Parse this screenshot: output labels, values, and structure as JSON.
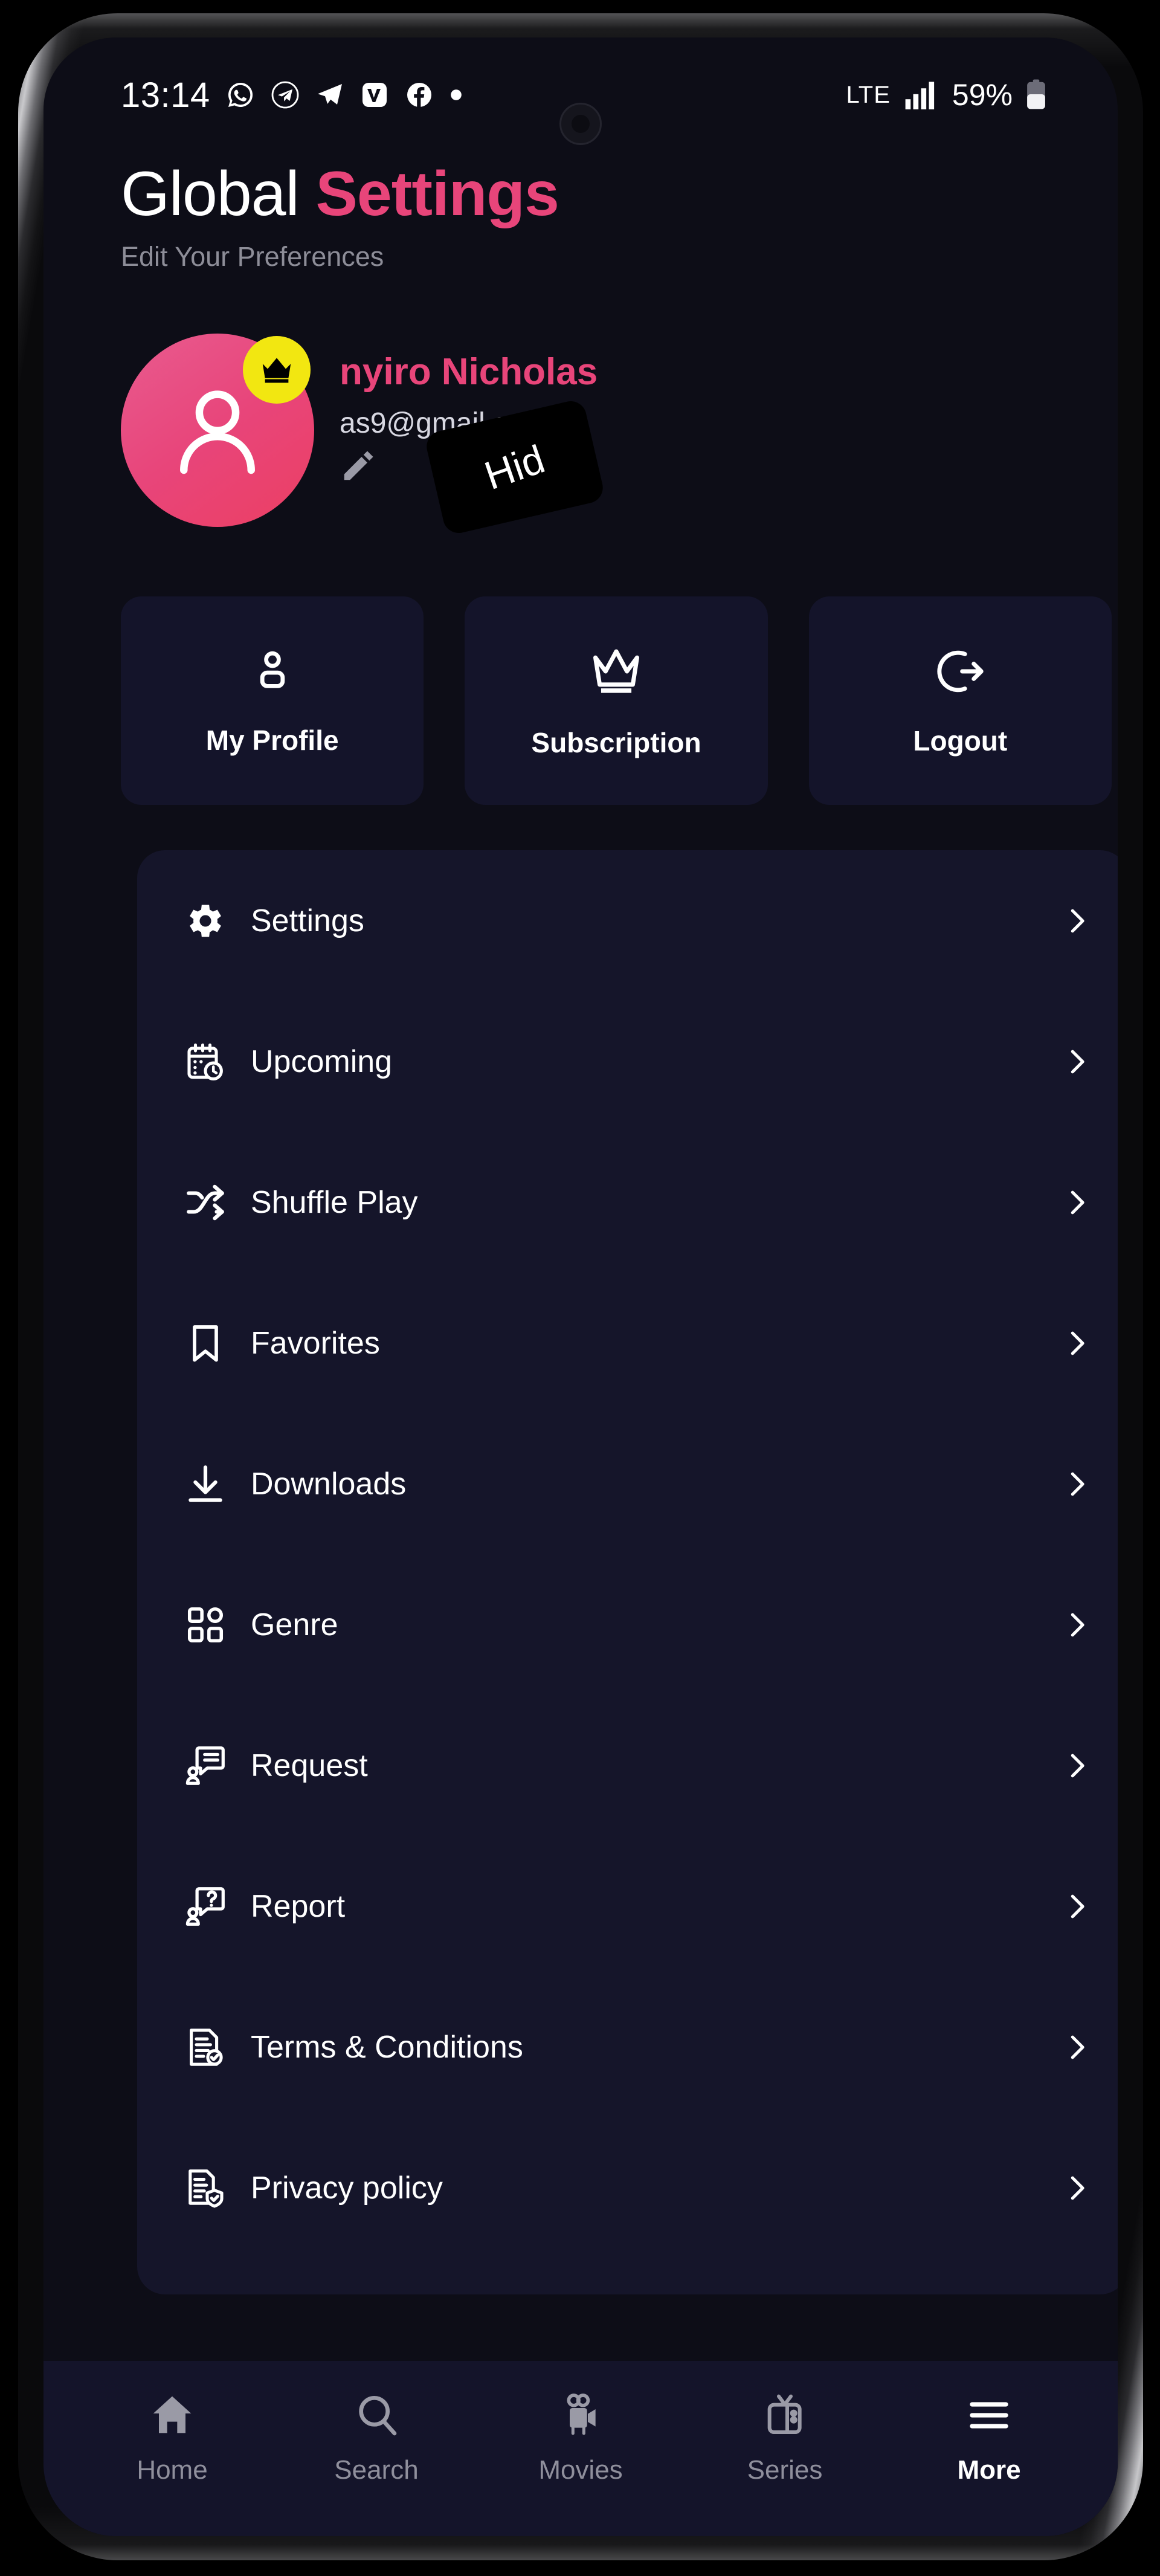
{
  "status_bar": {
    "time": "13:14",
    "app_icons": [
      "whatsapp-icon",
      "telegram-alt-icon",
      "telegram-icon",
      "vimeo-icon",
      "facebook-icon",
      "dot-icon"
    ],
    "network": "LTE",
    "signal": "signal-bars-icon",
    "battery_percent": "59%",
    "battery": "battery-icon"
  },
  "header": {
    "title_primary": "Global",
    "title_accent": "Settings",
    "subtitle": "Edit Your Preferences"
  },
  "profile": {
    "name": "nyiro Nicholas",
    "email": "as9@gmail.com",
    "badge_icon": "crown-icon",
    "avatar_icon": "person-icon",
    "edit_icon": "pencil-icon",
    "overlay_label": "Hid"
  },
  "quick_actions": [
    {
      "label": "My Profile",
      "icon": "person-icon"
    },
    {
      "label": "Subscription",
      "icon": "crown-icon"
    },
    {
      "label": "Logout",
      "icon": "logout-icon"
    }
  ],
  "menu": [
    {
      "label": "Settings",
      "icon": "gear-icon"
    },
    {
      "label": "Upcoming",
      "icon": "calendar-clock-icon"
    },
    {
      "label": "Shuffle Play",
      "icon": "shuffle-icon"
    },
    {
      "label": "Favorites",
      "icon": "bookmark-icon"
    },
    {
      "label": "Downloads",
      "icon": "download-icon"
    },
    {
      "label": "Genre",
      "icon": "grid-icon"
    },
    {
      "label": "Request",
      "icon": "person-message-icon"
    },
    {
      "label": "Report",
      "icon": "person-question-icon"
    },
    {
      "label": "Terms & Conditions",
      "icon": "document-check-icon"
    },
    {
      "label": "Privacy policy",
      "icon": "document-shield-icon"
    }
  ],
  "bottom_nav": [
    {
      "label": "Home",
      "icon": "home-icon",
      "active": false
    },
    {
      "label": "Search",
      "icon": "search-icon",
      "active": false
    },
    {
      "label": "Movies",
      "icon": "movie-camera-icon",
      "active": false
    },
    {
      "label": "Series",
      "icon": "tv-icon",
      "active": false
    },
    {
      "label": "More",
      "icon": "hamburger-icon",
      "active": true
    }
  ],
  "colors": {
    "accent_pink": "#e8457a",
    "badge_yellow": "#f2e711",
    "screen_bg": "#0d0d17",
    "card_bg": "#15152a",
    "muted_text": "#8d8d98"
  }
}
